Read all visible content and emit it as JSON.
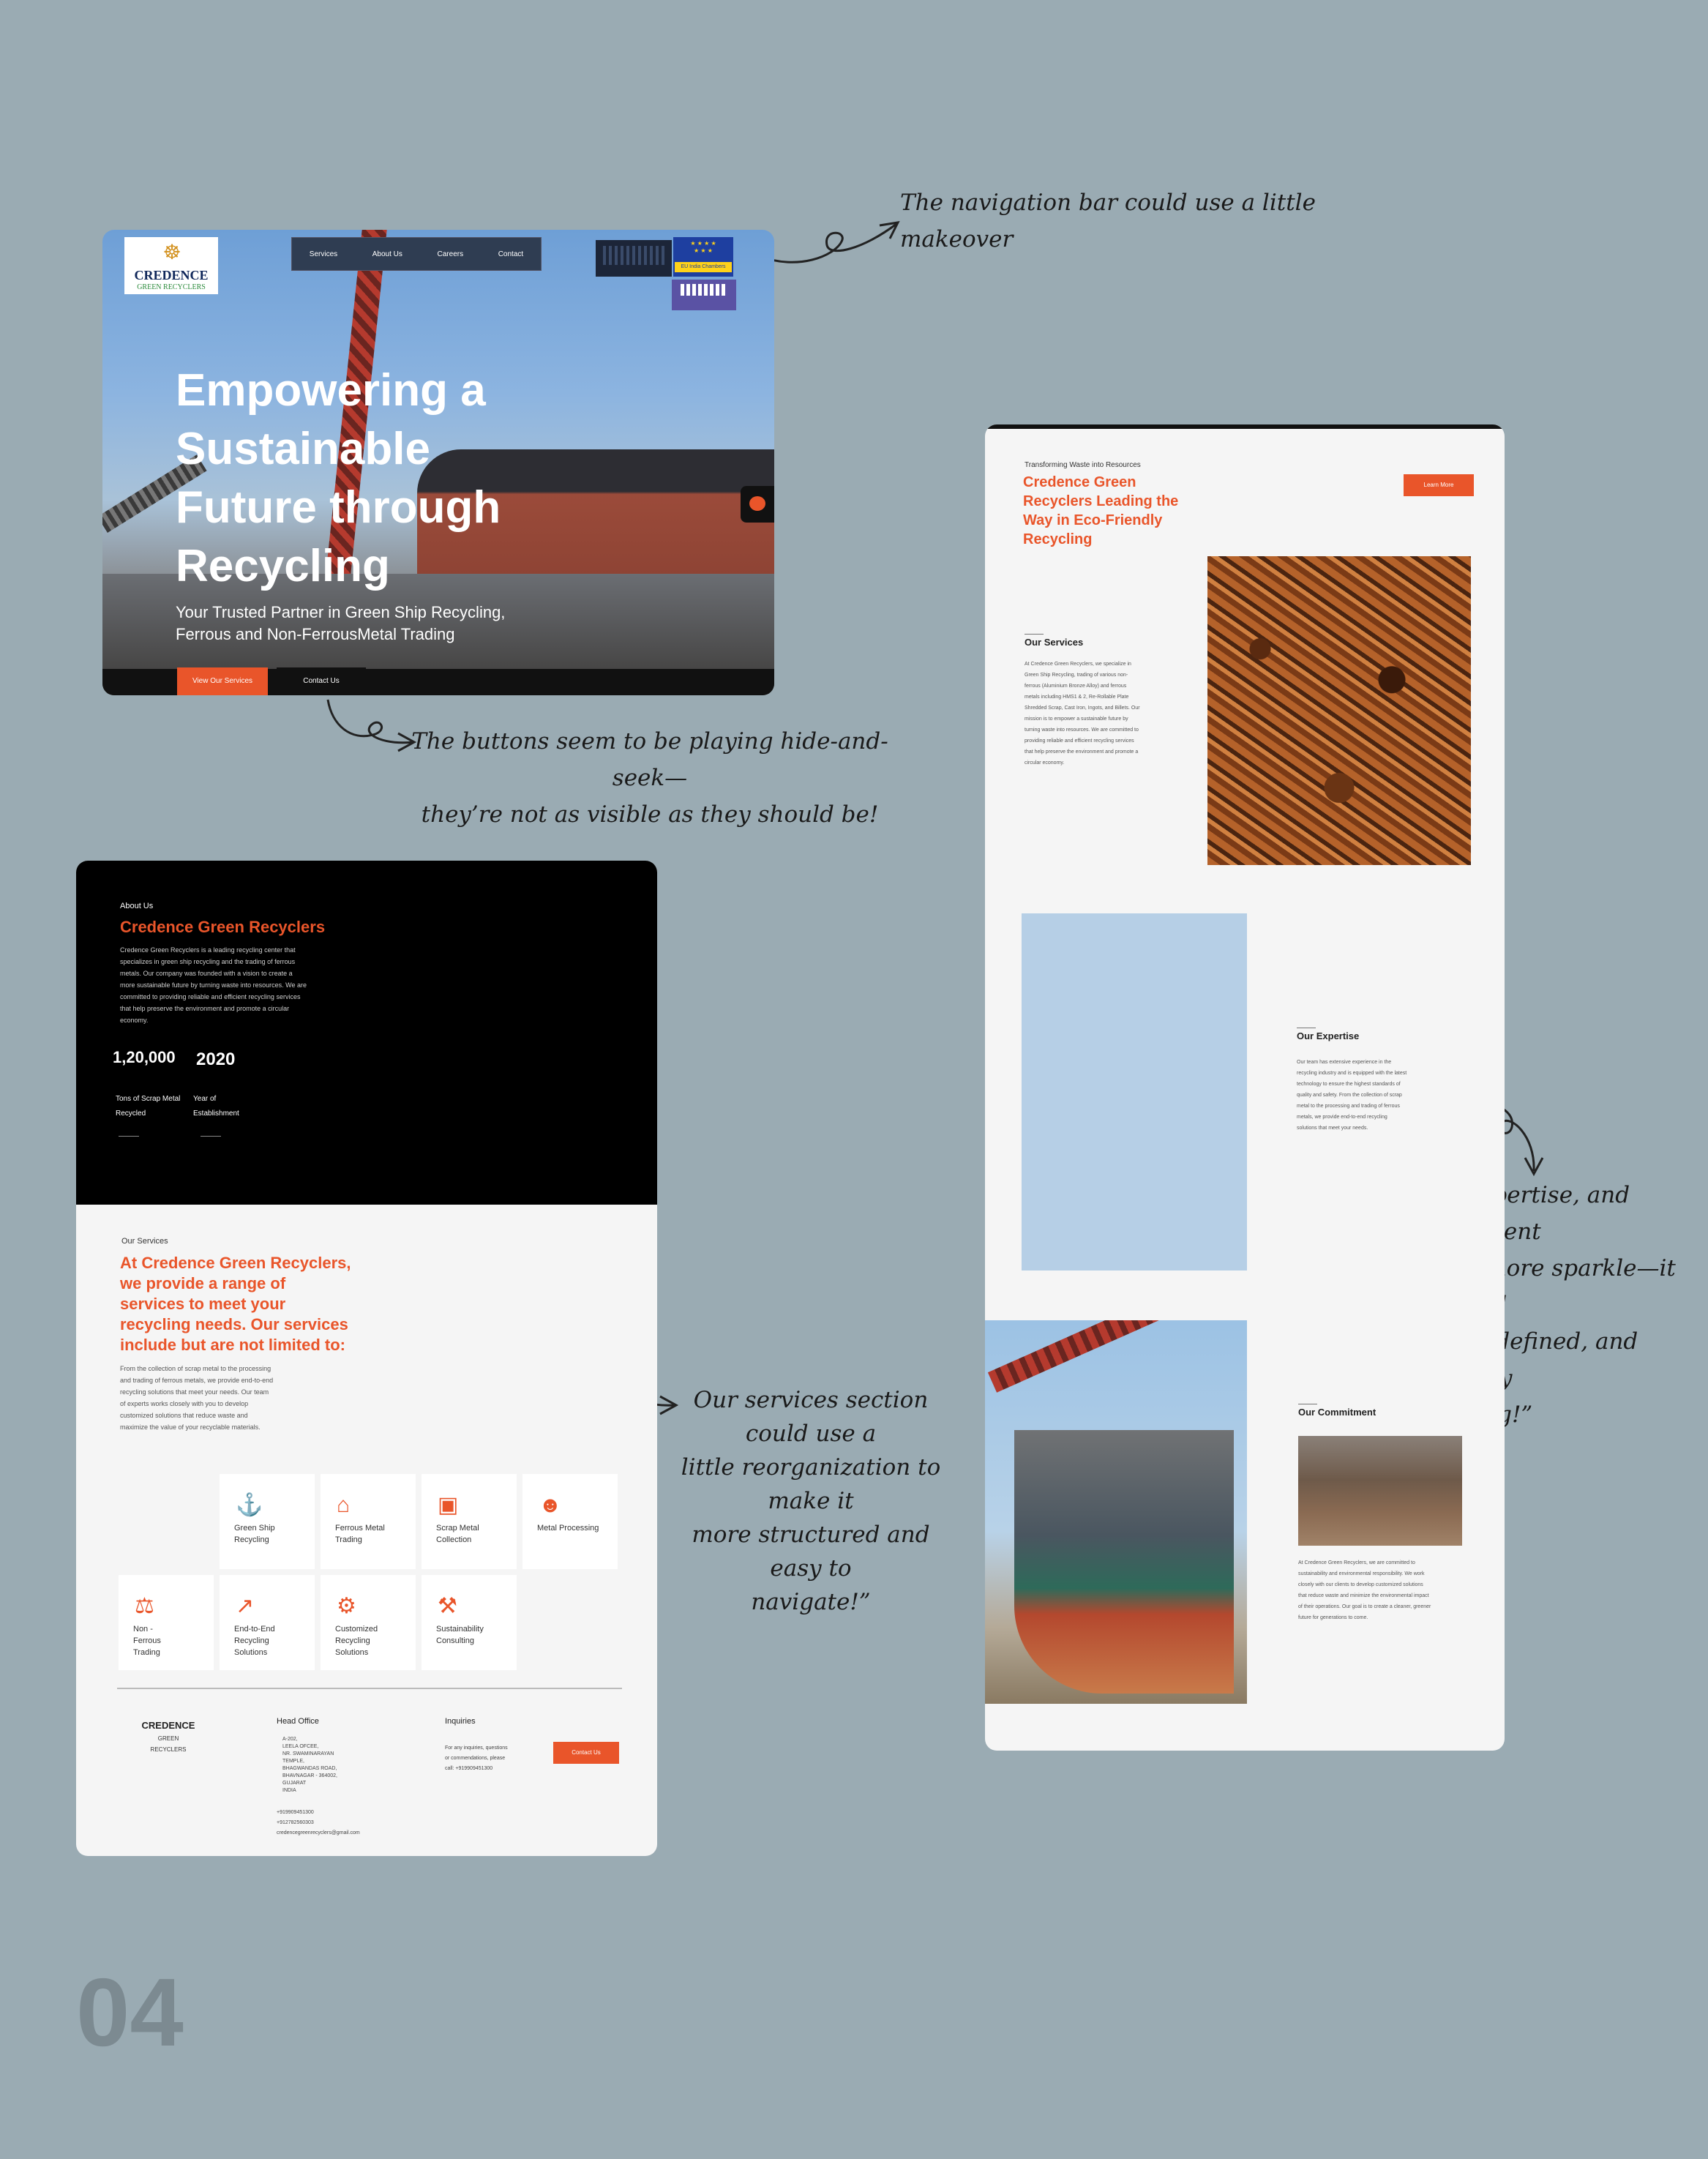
{
  "annotations": {
    "nav_note": "The navigation bar could use a little makeover",
    "buttons_note_line1": "The buttons seem to be playing hide-and-seek—",
    "buttons_note_line2": "they’re not as visible as they should be!",
    "expertise_note_line1": "The services, expertise, and commitment",
    "expertise_note_line2": "section needs a bit more sparkle—it should",
    "expertise_note_line3": "be clearer, more defined, and visually",
    "expertise_note_line4": "engaging!”",
    "services_note_line1": "Our services section could use a",
    "services_note_line2": "little reorganization to make it",
    "services_note_line3": "more structured and easy to",
    "services_note_line4": "navigate!”"
  },
  "page_number": "04",
  "hero": {
    "logo_title": "CREDENCE",
    "logo_subtitle": "GREEN RECYCLERS",
    "nav": [
      "Services",
      "About Us",
      "Careers",
      "Contact"
    ],
    "headline": "Empowering a Sustainable Future through Recycling",
    "subtitle_line1": "Your Trusted Partner in Green Ship Recycling,",
    "subtitle_line2": "Ferrous and Non-FerrousMetal Trading",
    "primary_button": "View Our Services",
    "secondary_button": "Contact Us",
    "badge_eu": "EU India Chambers"
  },
  "about": {
    "eyebrow": "About Us",
    "title": "Credence Green Recyclers",
    "body": [
      "Credence Green Recyclers is a leading recycling center that",
      "specializes in green ship recycling and the trading of ferrous",
      "metals. Our company was founded with a vision to create a",
      "more sustainable future by turning waste into resources. We are",
      "committed to providing reliable and efficient recycling services",
      "that help preserve the environment and promote a circular",
      "economy."
    ],
    "stats": [
      {
        "value": "1,20,000",
        "label_line1": "Tons of Scrap Metal",
        "label_line2": "Recycled"
      },
      {
        "value": "2020",
        "label_line1": "Year of",
        "label_line2": "Establishment"
      }
    ]
  },
  "services": {
    "eyebrow": "Our Services",
    "headline": [
      "At Credence Green Recyclers,",
      "we provide a range of",
      "services to meet your",
      "recycling needs. Our services",
      "include but are not limited to:"
    ],
    "body": [
      "From the collection of scrap metal to the processing",
      "and trading of ferrous metals, we provide end-to-end",
      "recycling solutions that meet your needs. Our team",
      "of experts works closely with you to develop",
      "customized solutions that reduce waste and",
      "maximize the value of your recyclable materials."
    ],
    "tiles": [
      {
        "icon": "ship-icon",
        "glyph": "⚓",
        "label": "Green Ship Recycling"
      },
      {
        "icon": "factory-icon",
        "glyph": "⌂",
        "label": "Ferrous Metal Trading"
      },
      {
        "icon": "box-icon",
        "glyph": "▣",
        "label": "Scrap Metal Collection"
      },
      {
        "icon": "worker-icon",
        "glyph": "☻",
        "label": "Metal Processing"
      },
      {
        "icon": "scale-icon",
        "glyph": "⚖",
        "label": "Non - Ferrous Trading"
      },
      {
        "icon": "chart-icon",
        "glyph": "↗",
        "label": "End-to-End Recycling Solutions"
      },
      {
        "icon": "gears-icon",
        "glyph": "⚙",
        "label": "Customized Recycling Solutions"
      },
      {
        "icon": "wrench-icon",
        "glyph": "⚒",
        "label": "Sustainability Consulting"
      }
    ]
  },
  "footer": {
    "brand_line1": "CREDENCE",
    "brand_line2": "GREEN",
    "brand_line3": "RECYCLERS",
    "office_title": "Head Office",
    "address": [
      "A-202,",
      "LEELA OFCEE,",
      "NR. SWAMINARAYAN",
      "TEMPLE,",
      "BHAGWANDAS ROAD,",
      "BHAVNAGAR - 364002,",
      "GUJARAT",
      "INDIA"
    ],
    "phone1": "+919909451300",
    "phone2": "+912782560303",
    "email": "credencegreenrecyclers@gmail.com",
    "inquiries_title": "Inquiries",
    "inquiries_text": [
      "For any inquiries, questions",
      "or commendations, please",
      "call: +919909451300"
    ],
    "contact_button": "Contact Us"
  },
  "right": {
    "eyebrow": "Transforming Waste into Resources",
    "headline": [
      "Credence Green",
      "Recyclers Leading the",
      "Way in Eco-Friendly",
      "Recycling"
    ],
    "learn_more": "Learn More",
    "services_title": "Our Services",
    "services_body": [
      "At Credence Green Recyclers, we specialize in",
      "Green Ship Recycling, trading of various non-",
      "ferrous (Aluminium Bronze Alloy) and ferrous",
      "metals including HMS1 & 2, Re-Rollable Plate",
      "Shredded Scrap, Cast Iron, Ingots, and Billets. Our",
      "mission is to empower a sustainable future by",
      "turning waste into resources. We are committed to",
      "providing reliable and efficient recycling services",
      "that help preserve the environment and promote a",
      "circular economy."
    ],
    "expertise_title": "Our Expertise",
    "expertise_body": [
      "Our team has extensive experience in the",
      "recycling industry and is equipped with the latest",
      "technology to ensure the highest standards of",
      "quality and safety. From the collection of scrap",
      "metal to the processing and trading of ferrous",
      "metals, we provide end-to-end recycling",
      "solutions that meet your needs."
    ],
    "commitment_title": "Our Commitment",
    "commitment_body": [
      "At Credence Green Recyclers, we are committed to",
      "sustainability and environmental responsibility. We work",
      "closely with our clients to develop customized solutions",
      "that reduce waste and minimize the environmental impact",
      "of their operations. Our goal is to create a cleaner, greener",
      "future for generations to come."
    ]
  },
  "colors": {
    "accent": "#e9552a",
    "background": "#9aabb3",
    "dark": "#000000",
    "panel": "#b6cfe6"
  }
}
